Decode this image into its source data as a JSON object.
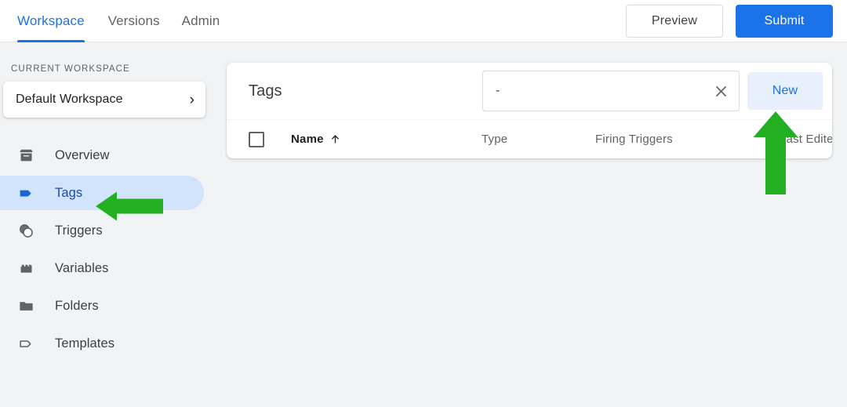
{
  "header": {
    "tabs": [
      {
        "label": "Workspace",
        "active": true
      },
      {
        "label": "Versions",
        "active": false
      },
      {
        "label": "Admin",
        "active": false
      }
    ],
    "preview_label": "Preview",
    "submit_label": "Submit",
    "accent_color": "#1a73e8"
  },
  "sidebar": {
    "section_label": "CURRENT WORKSPACE",
    "workspace_name": "Default Workspace",
    "workspace_chevron": "chevron-right-icon",
    "items": [
      {
        "label": "Overview",
        "icon": "archive-box-icon",
        "active": false
      },
      {
        "label": "Tags",
        "icon": "tag-filled-icon",
        "active": true
      },
      {
        "label": "Triggers",
        "icon": "overlapping-circles-icon",
        "active": false
      },
      {
        "label": "Variables",
        "icon": "brick-icon",
        "active": false
      },
      {
        "label": "Folders",
        "icon": "folder-icon",
        "active": false
      },
      {
        "label": "Templates",
        "icon": "tag-outline-icon",
        "active": false
      }
    ],
    "active_bg_color": "#d2e3fc"
  },
  "main": {
    "card_title": "Tags",
    "search": {
      "value": "-",
      "placeholder": "",
      "clear_icon": "close-x-icon"
    },
    "new_button_label": "New",
    "new_button_bg": "#e8f0fe",
    "table": {
      "select_all_checkbox": false,
      "columns": [
        {
          "label": "Name",
          "sort": "ascending",
          "sort_icon": "arrow-up-icon"
        },
        {
          "label": "Type"
        },
        {
          "label": "Firing Triggers"
        },
        {
          "label": "Last Edited"
        }
      ],
      "rows": []
    }
  },
  "annotations": {
    "color": "#22b022",
    "arrows": [
      {
        "name": "arrow-pointing-to-tags",
        "direction": "left"
      },
      {
        "name": "arrow-pointing-to-new-button",
        "direction": "up"
      }
    ]
  }
}
